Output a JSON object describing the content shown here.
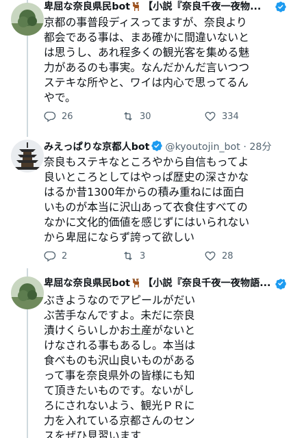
{
  "tweets": [
    {
      "display_name": "卑屈な奈良県民bot",
      "title": "【小説『奈良千夜一夜物...",
      "lines": [
        "京都の事普段ディスってますが、奈良より",
        "都会である事は、まあ確かに間違いないと",
        "は思うし、あれ程多くの観光客を集める魅",
        "力があるのも事実。なんだかんだ言いつつ",
        "ステキな所やと、ワイは内心で思ってるん",
        "やで。"
      ],
      "replies": "26",
      "retweets": "30",
      "likes": "334"
    },
    {
      "display_name": "みえっぱりな京都人bot",
      "handle": "@kyoutojin_bot",
      "time": "· 28分",
      "lines": [
        "奈良もステキなところやから自信もってよ",
        "良いところとしてはやっぱ歴史の深さかな",
        "はるか昔1300年からの積み重ねには面白",
        "いものが本当に沢山あって衣食住すべての",
        "なかに文化的価値を感じずにはいられない",
        "から卑屈にならず誇って欲しい"
      ],
      "replies": "2",
      "retweets": "3",
      "likes": "28"
    },
    {
      "display_name": "卑屈な奈良県民bot",
      "title": "【小説『奈良千夜一夜物語...",
      "lines": [
        "ぶきようなのでアピールがだい",
        "ぶ苦手なんですよ。未だに奈良",
        "漬けくらいしかお土産がないと",
        "けなされる事もあるし。本当は",
        "食べものも沢山良いものがある",
        "って事を奈良県外の皆様にも知",
        "て頂きたいものです。ないがし",
        "ろにされないよう、観光ＰＲに",
        "力を入れている京都さんのセン",
        "スをぜひ見習います"
      ]
    }
  ],
  "icons": {
    "verified": "verified-badge-icon",
    "deer": "deer-emoji-icon",
    "reply": "reply-icon",
    "retweet": "retweet-icon",
    "like": "heart-icon"
  },
  "colors": {
    "text": "#0f1419",
    "secondary": "#536471",
    "verified": "#1d9bf0",
    "thread_line": "#cfd9de"
  }
}
